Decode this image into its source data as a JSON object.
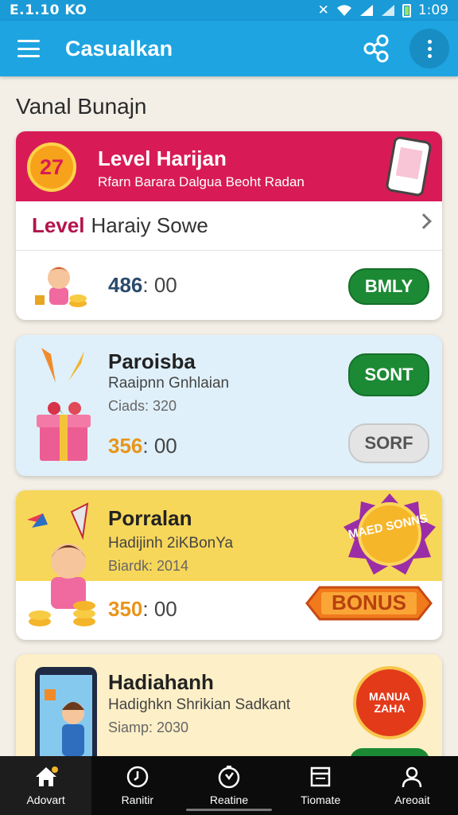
{
  "status_bar": {
    "left_text": "E.1.10 KO",
    "time": "1:09"
  },
  "app_bar": {
    "title": "Casualkan"
  },
  "section_title": "Vanal Bunajn",
  "card1": {
    "medal_text": "27",
    "title": "Level Harijan",
    "subtitle": "Rfarn Barara Dalgua Beoht Radan",
    "row_level": "Level",
    "row_rest": "Haraiy Sowe",
    "amount_num": "486",
    "amount_rest": ": 00",
    "button_label": "BMLY"
  },
  "card2": {
    "title": "Paroisba",
    "subtitle": "Raaipnn Gnhlaian",
    "meta": "Ciads: 320",
    "amount_num": "356",
    "amount_rest": ": 00",
    "button_primary": "SONT",
    "button_secondary": "SORF"
  },
  "card3": {
    "title": "Porralan",
    "subtitle": "Hadijinh 2iKBonYa",
    "meta": "Biardk: 2014",
    "amount_num": "350",
    "amount_rest": ": 00",
    "badge_text": "MAED SONNS",
    "bonus_label": "BONUS"
  },
  "card4": {
    "title": "Hadiahanh",
    "subtitle": "Hadighkn Shrikian Sadkant",
    "meta": "Siamp: 2030",
    "badge_text": "MANUA ZAHA"
  },
  "bottom_nav": [
    {
      "label": "Adovart",
      "icon": "home-icon"
    },
    {
      "label": "Ranitir",
      "icon": "clock-icon"
    },
    {
      "label": "Reatine",
      "icon": "stopwatch-icon"
    },
    {
      "label": "Tiomate",
      "icon": "window-icon"
    },
    {
      "label": "Areoait",
      "icon": "person-icon"
    }
  ],
  "colors": {
    "app_bar": "#1ea4e0",
    "card1_header": "#d81b57",
    "button_green": "#1c8a35",
    "card3_top": "#f7d75a",
    "amount_orange": "#e8951a",
    "amount_navy": "#2b4a6b"
  }
}
